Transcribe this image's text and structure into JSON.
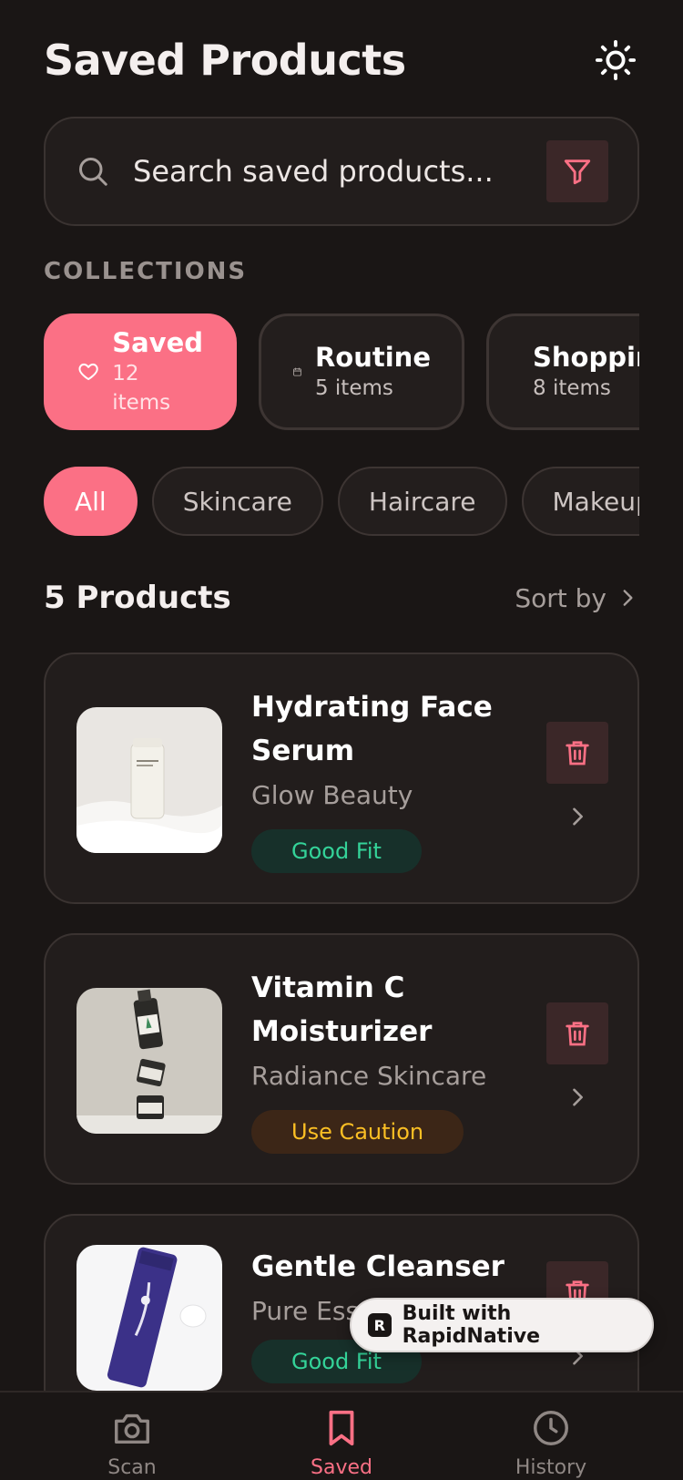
{
  "header": {
    "title": "Saved Products"
  },
  "search": {
    "placeholder": "Search saved products..."
  },
  "collections": {
    "label": "COLLECTIONS",
    "items": [
      {
        "name": "Saved",
        "count": "12 items",
        "icon": "heart-icon"
      },
      {
        "name": "Routine",
        "count": "5 items",
        "icon": "calendar-icon"
      },
      {
        "name": "Shopping",
        "count": "8 items",
        "icon": "shopping-bag-icon"
      }
    ]
  },
  "filters": [
    "All",
    "Skincare",
    "Haircare",
    "Makeup"
  ],
  "list": {
    "count_label": "5 Products",
    "sort_label": "Sort by"
  },
  "products": [
    {
      "name": "Hydrating Face Serum",
      "brand": "Glow Beauty",
      "badge": "Good Fit",
      "status": "good"
    },
    {
      "name": "Vitamin C Moisturizer",
      "brand": "Radiance Skincare",
      "badge": "Use Caution",
      "status": "caution"
    },
    {
      "name": "Gentle Cleanser",
      "brand": "Pure Ess",
      "badge": "Good Fit",
      "status": "good"
    }
  ],
  "nav": [
    {
      "label": "Scan",
      "icon": "camera-icon"
    },
    {
      "label": "Saved",
      "icon": "bookmark-icon",
      "active": true
    },
    {
      "label": "History",
      "icon": "clock-icon"
    }
  ],
  "built_badge": "Built with RapidNative",
  "colors": {
    "accent": "#fb7085",
    "good": "#34d399",
    "caution": "#fbbf24",
    "background": "#1a1615"
  }
}
